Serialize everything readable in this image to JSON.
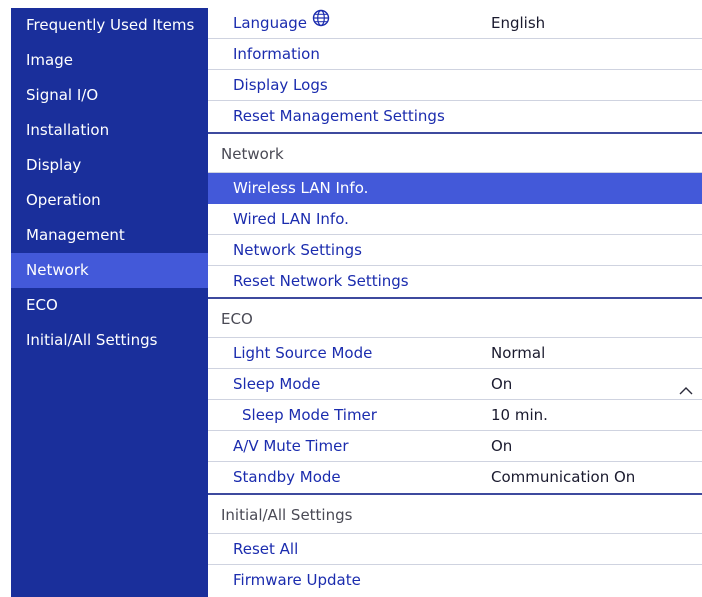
{
  "sidebar": {
    "items": [
      {
        "label": "Frequently Used Items"
      },
      {
        "label": "Image"
      },
      {
        "label": "Signal I/O"
      },
      {
        "label": "Installation"
      },
      {
        "label": "Display"
      },
      {
        "label": "Operation"
      },
      {
        "label": "Management"
      },
      {
        "label": "Network"
      },
      {
        "label": "ECO"
      },
      {
        "label": "Initial/All Settings"
      }
    ],
    "active": "Network"
  },
  "management": {
    "language_label": "Language",
    "language_value": "English",
    "information": "Information",
    "display_logs": "Display Logs",
    "reset_management": "Reset Management Settings"
  },
  "network": {
    "header": "Network",
    "wireless_lan_info": "Wireless LAN Info.",
    "wired_lan_info": "Wired LAN Info.",
    "network_settings": "Network Settings",
    "reset_network": "Reset Network Settings"
  },
  "eco": {
    "header": "ECO",
    "light_source_label": "Light Source Mode",
    "light_source_value": "Normal",
    "sleep_mode_label": "Sleep Mode",
    "sleep_mode_value": "On",
    "sleep_timer_label": "Sleep Mode Timer",
    "sleep_timer_value": "10 min.",
    "av_mute_label": "A/V Mute Timer",
    "av_mute_value": "On",
    "standby_label": "Standby Mode",
    "standby_value": "Communication On"
  },
  "initial": {
    "header": "Initial/All Settings",
    "reset_all": "Reset All",
    "firmware_update": "Firmware Update"
  },
  "icons": {
    "globe": "globe-icon",
    "collapse": "chevron-up-icon"
  },
  "colors": {
    "sidebar_bg": "#1a2f9b",
    "highlight": "#4359d9",
    "item_text": "#1b2cae"
  }
}
